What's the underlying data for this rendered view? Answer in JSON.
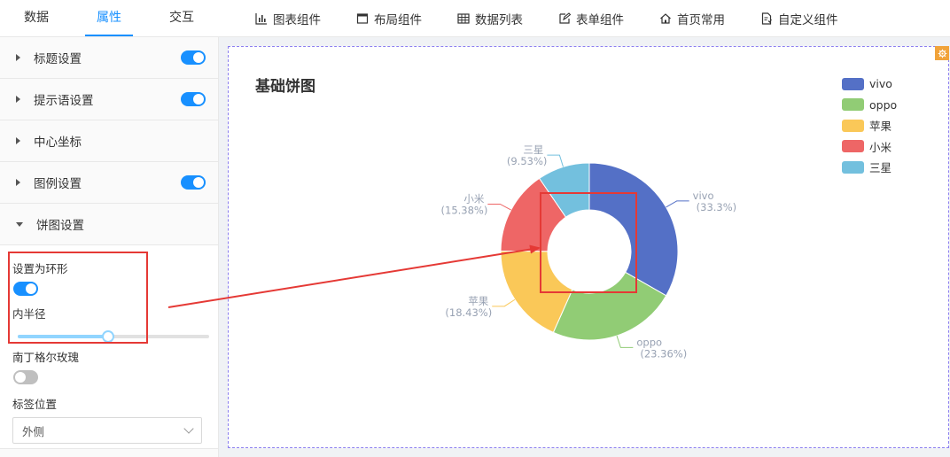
{
  "tabs": [
    {
      "label": "数据",
      "active": false
    },
    {
      "label": "属性",
      "active": true
    },
    {
      "label": "交互",
      "active": false
    }
  ],
  "toolbar": [
    {
      "label": "图表组件",
      "icon": "bar-chart-icon"
    },
    {
      "label": "布局组件",
      "icon": "layout-icon"
    },
    {
      "label": "数据列表",
      "icon": "table-icon"
    },
    {
      "label": "表单组件",
      "icon": "edit-form-icon"
    },
    {
      "label": "首页常用",
      "icon": "home-icon"
    },
    {
      "label": "自定义组件",
      "icon": "custom-doc-icon"
    }
  ],
  "sections": [
    {
      "label": "标题设置",
      "toggle": true
    },
    {
      "label": "提示语设置",
      "toggle": true
    },
    {
      "label": "中心坐标",
      "toggle": null
    },
    {
      "label": "图例设置",
      "toggle": true
    },
    {
      "label": "饼图设置",
      "toggle": null,
      "expanded": true
    }
  ],
  "pie_settings": {
    "ring_label": "设置为环形",
    "ring_on": true,
    "inner_radius_label": "内半径",
    "inner_radius_value": 0.47,
    "rose_label": "南丁格尔玫瑰",
    "rose_on": false,
    "label_position_label": "标签位置",
    "label_position_value": "外侧"
  },
  "colors": {
    "accent": "#1890ff",
    "highlight": "#e53935",
    "card_border": "#8c7ff0",
    "gear": "#f1a33a"
  },
  "chart_data": {
    "type": "pie",
    "title": "基础饼图",
    "donut": true,
    "legend_position": "top-right",
    "slices": [
      {
        "name": "vivo",
        "value": 33.3,
        "label": "vivo",
        "pct_label": "(33.3%)",
        "color": "#5470c6"
      },
      {
        "name": "oppo",
        "value": 23.36,
        "label": "oppo",
        "pct_label": "(23.36%)",
        "color": "#91cc75"
      },
      {
        "name": "苹果",
        "value": 18.43,
        "label": "苹果",
        "pct_label": "(18.43%)",
        "color": "#fac858"
      },
      {
        "name": "小米",
        "value": 15.38,
        "label": "小米",
        "pct_label": "(15.38%)",
        "color": "#ee6666"
      },
      {
        "name": "三星",
        "value": 9.53,
        "label": "三星",
        "pct_label": "(9.53%)",
        "color": "#73c0de"
      }
    ]
  }
}
